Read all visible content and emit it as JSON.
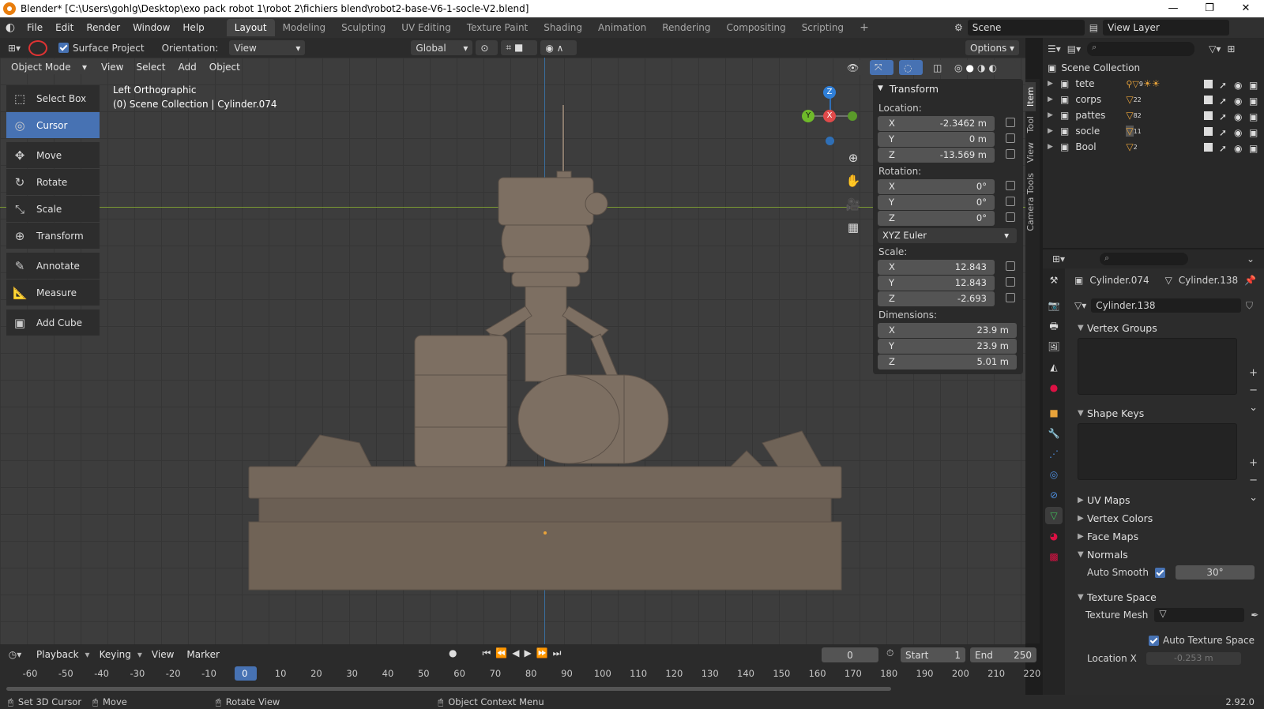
{
  "title": "Blender* [C:\\Users\\gohlg\\Desktop\\exo pack robot 1\\robot 2\\fichiers blend\\robot2-base-V6-1-socle-V2.blend]",
  "window_controls": [
    "—",
    "❐",
    "✕"
  ],
  "menus": [
    "File",
    "Edit",
    "Render",
    "Window",
    "Help"
  ],
  "workspaces": [
    "Layout",
    "Modeling",
    "Sculpting",
    "UV Editing",
    "Texture Paint",
    "Shading",
    "Animation",
    "Rendering",
    "Compositing",
    "Scripting"
  ],
  "scene": "Scene",
  "view_layer": "View Layer",
  "header": {
    "surface_project": "Surface Project",
    "orientation_label": "Orientation:",
    "orientation_value": "View",
    "transform_orientation": "Global",
    "options": "Options",
    "mode": "Object Mode",
    "view_menu": [
      "View",
      "Select",
      "Add",
      "Object"
    ]
  },
  "viewport": {
    "view_name": "Left Orthographic",
    "collection_info": "(0) Scene Collection | Cylinder.074",
    "axis_z": "Z",
    "axis_y": "Y",
    "axis_x": "X"
  },
  "tools": [
    {
      "label": "Select Box",
      "icon": "⬚"
    },
    {
      "label": "Cursor",
      "icon": "◎"
    },
    {
      "label": "Move",
      "icon": "✥"
    },
    {
      "label": "Rotate",
      "icon": "↻"
    },
    {
      "label": "Scale",
      "icon": "⤡"
    },
    {
      "label": "Transform",
      "icon": "⊕"
    },
    {
      "label": "Annotate",
      "icon": "✎"
    },
    {
      "label": "Measure",
      "icon": "📐"
    },
    {
      "label": "Add Cube",
      "icon": "▣"
    }
  ],
  "transform": {
    "title": "Transform",
    "location_label": "Location:",
    "location": [
      {
        "axis": "X",
        "value": "-2.3462 m"
      },
      {
        "axis": "Y",
        "value": "0 m"
      },
      {
        "axis": "Z",
        "value": "-13.569 m"
      }
    ],
    "rotation_label": "Rotation:",
    "rotation": [
      {
        "axis": "X",
        "value": "0°"
      },
      {
        "axis": "Y",
        "value": "0°"
      },
      {
        "axis": "Z",
        "value": "0°"
      }
    ],
    "rotation_mode": "XYZ Euler",
    "scale_label": "Scale:",
    "scale": [
      {
        "axis": "X",
        "value": "12.843"
      },
      {
        "axis": "Y",
        "value": "12.843"
      },
      {
        "axis": "Z",
        "value": "-2.693"
      }
    ],
    "dimensions_label": "Dimensions:",
    "dimensions": [
      {
        "axis": "X",
        "value": "23.9 m"
      },
      {
        "axis": "Y",
        "value": "23.9 m"
      },
      {
        "axis": "Z",
        "value": "5.01 m"
      }
    ]
  },
  "npanel_tabs": [
    "Item",
    "Tool",
    "View",
    "Camera Tools"
  ],
  "outliner": {
    "root": "Scene Collection",
    "items": [
      {
        "name": "tete",
        "badge": "9"
      },
      {
        "name": "corps",
        "badge": "22"
      },
      {
        "name": "pattes",
        "badge": "82"
      },
      {
        "name": "socle",
        "badge": "11"
      },
      {
        "name": "Bool",
        "badge": "2"
      }
    ]
  },
  "properties": {
    "object_name": "Cylinder.074",
    "mesh_name": "Cylinder.138",
    "data_block": "Cylinder.138",
    "sections": {
      "vertex_groups": "Vertex Groups",
      "shape_keys": "Shape Keys",
      "uv_maps": "UV Maps",
      "vertex_colors": "Vertex Colors",
      "face_maps": "Face Maps",
      "normals": "Normals",
      "texture_space": "Texture Space"
    },
    "auto_smooth_label": "Auto Smooth",
    "auto_smooth_angle": "30°",
    "texture_mesh_label": "Texture Mesh",
    "auto_texture_space": "Auto Texture Space",
    "location_x_label": "Location X",
    "location_x_value": "-0.253 m"
  },
  "timeline": {
    "menus": [
      "Playback",
      "Keying",
      "View",
      "Marker"
    ],
    "current_frame": "0",
    "start_label": "Start",
    "start": "1",
    "end_label": "End",
    "end": "250",
    "ticks": [
      "-60",
      "-50",
      "-40",
      "-30",
      "-20",
      "-10",
      "0",
      "10",
      "20",
      "30",
      "40",
      "50",
      "60",
      "70",
      "80",
      "90",
      "100",
      "110",
      "120",
      "130",
      "140",
      "150",
      "160",
      "170",
      "180",
      "190",
      "200",
      "210",
      "220"
    ]
  },
  "status": {
    "set_cursor": "Set 3D Cursor",
    "move": "Move",
    "rotate_view": "Rotate View",
    "context_menu": "Object Context Menu",
    "version": "2.92.0"
  }
}
